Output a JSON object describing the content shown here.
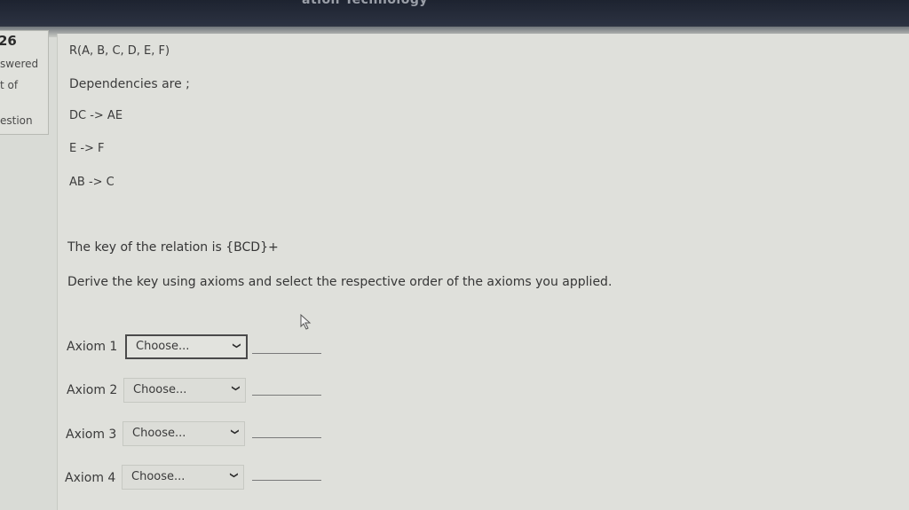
{
  "sidebar": {
    "number": "26",
    "answered": "swered",
    "out_of": "t of",
    "question": "estion"
  },
  "header": {
    "title": "ation Technology"
  },
  "question": {
    "relation": "R(A, B, C, D, E, F)",
    "dependencies_label": "Dependencies are ;",
    "dependencies": [
      "DC -> AE",
      "E -> F",
      "AB -> C"
    ],
    "key_statement": "The key of the relation is {BCD}+",
    "instruction": "Derive the key using axioms and select the respective order of the axioms you applied."
  },
  "axioms": [
    {
      "label": "Axiom 1",
      "value": "Choose..."
    },
    {
      "label": "Axiom 2",
      "value": "Choose..."
    },
    {
      "label": "Axiom 3",
      "value": "Choose..."
    },
    {
      "label": "Axiom 4",
      "value": "Choose..."
    }
  ]
}
